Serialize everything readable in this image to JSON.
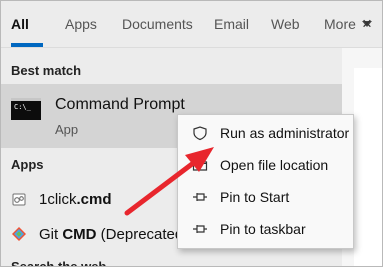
{
  "tabs": [
    {
      "label": "All"
    },
    {
      "label": "Apps"
    },
    {
      "label": "Documents"
    },
    {
      "label": "Email"
    },
    {
      "label": "Web"
    },
    {
      "label": "More"
    }
  ],
  "close_glyph": "×",
  "best_match": {
    "heading": "Best match",
    "title": "Command Prompt",
    "subtitle": "App",
    "icon": "command-prompt-icon",
    "icon_glyph": "C:\\_"
  },
  "apps": {
    "heading": "Apps",
    "items": [
      {
        "prefix": "1click",
        "bold": ".cmd",
        "suffix": "",
        "icon": "cmd-file-icon"
      },
      {
        "prefix": "Git ",
        "bold": "CMD",
        "suffix": " (Deprecated",
        "icon": "git-icon"
      }
    ]
  },
  "search_heading_partial": "Search the web",
  "context_menu": {
    "items": [
      {
        "label": "Run as administrator",
        "icon": "shield-icon"
      },
      {
        "label": "Open file location",
        "icon": "folder-icon"
      },
      {
        "label": "Pin to Start",
        "icon": "pin-icon"
      },
      {
        "label": "Pin to taskbar",
        "icon": "pin-icon"
      }
    ]
  },
  "colors": {
    "accent": "#0067c0",
    "annotation_arrow": "#e8262d",
    "highlight_row": "#d4d4d4"
  }
}
